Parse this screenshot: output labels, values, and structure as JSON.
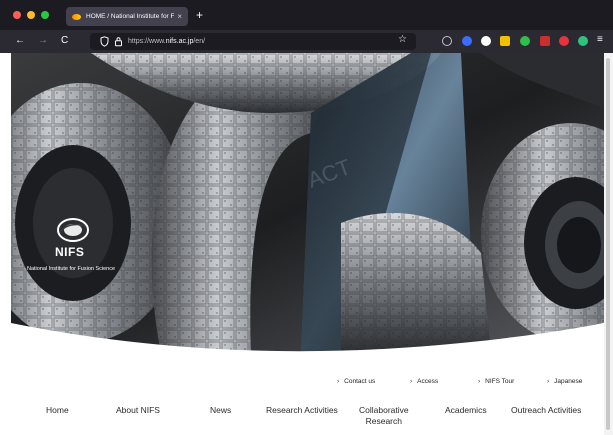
{
  "browser": {
    "tab_title": "HOME / National Institute for Fu",
    "tab_close": "×",
    "new_tab": "+",
    "back": "←",
    "forward": "→",
    "reload": "C",
    "url_prefix": "https://www.",
    "url_domain": "nifs.ac.jp",
    "url_suffix": "/en/",
    "bookmark_star": "☆",
    "menu": "≡",
    "extension_colors": [
      "#8c8c96",
      "#3b6cff",
      "#ffffff",
      "#f2c200",
      "#2fbf4a",
      "#c9302c",
      "#e8333d",
      "#2ec27e"
    ]
  },
  "hero": {
    "logo_name": "NIFS",
    "logo_subtitle": "National Institute for Fusion Science",
    "overlay_text": "ACT"
  },
  "utility_nav": [
    {
      "label": "Contact us",
      "chevron": "›"
    },
    {
      "label": "Access",
      "chevron": "›"
    },
    {
      "label": "NIFS Tour",
      "chevron": "›"
    },
    {
      "label": "Japanese",
      "chevron": "›"
    }
  ],
  "main_nav": [
    {
      "label": "Home"
    },
    {
      "label": "About NIFS"
    },
    {
      "label": "News"
    },
    {
      "label": "Research Activities"
    },
    {
      "label_line1": "Collaborative",
      "label_line2": "Research"
    },
    {
      "label": "Academics"
    },
    {
      "label": "Outreach Activities"
    }
  ],
  "colors": {
    "tabbar_bg": "#1c1b22",
    "toolbar_bg": "#2b2a33",
    "hero_dark": "#1f2022",
    "nav_text": "#2a2a2a"
  }
}
